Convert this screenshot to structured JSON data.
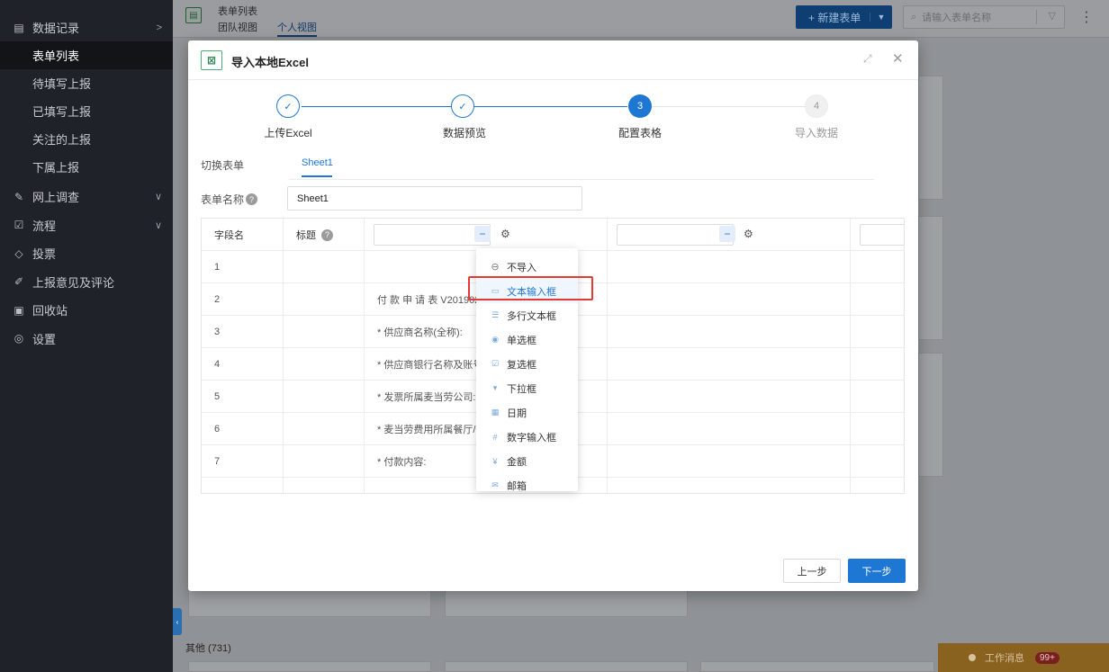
{
  "sidebar": {
    "groups": [
      {
        "icon": "document-icon",
        "label": "数据记录",
        "arrow": ">"
      },
      {
        "icon": "survey-icon",
        "label": "网上调查",
        "arrow": "∨"
      },
      {
        "icon": "flow-icon",
        "label": "流程",
        "arrow": "∨"
      },
      {
        "icon": "vote-icon",
        "label": "投票"
      },
      {
        "icon": "feedback-icon",
        "label": "上报意见及评论"
      },
      {
        "icon": "trash-icon",
        "label": "回收站"
      },
      {
        "icon": "settings-icon",
        "label": "设置"
      }
    ],
    "sub_items": [
      "表单列表",
      "待填写上报",
      "已填写上报",
      "关注的上报",
      "下属上报"
    ],
    "active_sub": "表单列表"
  },
  "header": {
    "title": "表单列表",
    "view_team": "团队视图",
    "view_personal": "个人视图",
    "new_form": "+ 新建表单",
    "search_placeholder": "请输入表单名称"
  },
  "background": {
    "other_label": "其他 (731)",
    "work_msg": "工作消息",
    "work_badge": "99+"
  },
  "modal": {
    "title": "导入本地Excel",
    "steps": [
      {
        "label": "上传Excel",
        "state": "done",
        "mark": "✓"
      },
      {
        "label": "数据预览",
        "state": "done",
        "mark": "✓"
      },
      {
        "label": "配置表格",
        "state": "current",
        "mark": "3"
      },
      {
        "label": "导入数据",
        "state": "todo",
        "mark": "4"
      }
    ],
    "switch_label": "切换表单",
    "sheet_tab": "Sheet1",
    "name_label": "表单名称",
    "name_value": "Sheet1",
    "table": {
      "head": {
        "field": "字段名",
        "title": "标题"
      },
      "rows": [
        {
          "no": "1",
          "content": ""
        },
        {
          "no": "2",
          "content": "付 款 申 请 表 V201902"
        },
        {
          "no": "3",
          "content": "* 供应商名称(全称):"
        },
        {
          "no": "4",
          "content": "* 供应商银行名称及账号"
        },
        {
          "no": "5",
          "content": "* 发票所属麦当劳公司:"
        },
        {
          "no": "6",
          "content": "* 麦当劳费用所属餐厅/部"
        },
        {
          "no": "7",
          "content": "* 付款内容:"
        }
      ]
    },
    "dropdown": [
      {
        "icon": "no-import-icon",
        "label": "不导入"
      },
      {
        "icon": "text-input-icon",
        "label": "文本输入框"
      },
      {
        "icon": "textarea-icon",
        "label": "多行文本框"
      },
      {
        "icon": "radio-icon",
        "label": "单选框"
      },
      {
        "icon": "checkbox-icon",
        "label": "复选框"
      },
      {
        "icon": "select-icon",
        "label": "下拉框"
      },
      {
        "icon": "date-icon",
        "label": "日期"
      },
      {
        "icon": "number-input-icon",
        "label": "数字输入框"
      },
      {
        "icon": "amount-icon",
        "label": "金额"
      },
      {
        "icon": "email-icon",
        "label": "邮箱"
      }
    ],
    "prev_label": "上一步",
    "next_label": "下一步"
  }
}
